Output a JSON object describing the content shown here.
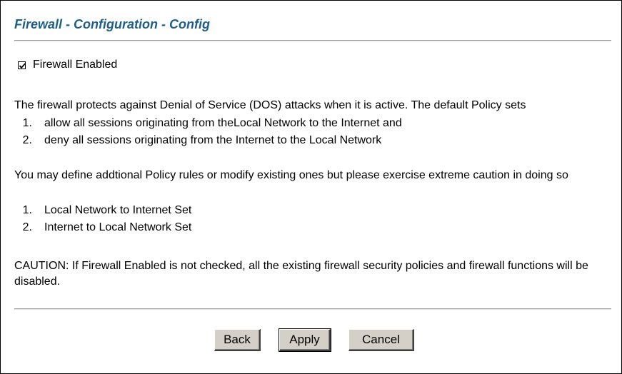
{
  "header": {
    "title": "Firewall - Configuration - Config"
  },
  "firewall": {
    "enabled_label": "Firewall Enabled",
    "enabled": true
  },
  "intro": {
    "text": "The firewall protects against Denial of Service (DOS) attacks when it is active. The default Policy sets",
    "items": [
      {
        "num": "1.",
        "text": "allow all sessions originating from theLocal Network to the Internet and"
      },
      {
        "num": "2.",
        "text": "deny all sessions originating from the Internet to the Local Network"
      }
    ]
  },
  "policy": {
    "text": "You may define addtional Policy rules or modify existing ones but please exercise extreme caution in doing so",
    "items": [
      {
        "num": "1.",
        "text": "Local Network to Internet Set"
      },
      {
        "num": "2.",
        "text": "Internet to Local Network Set"
      }
    ]
  },
  "caution": {
    "text": "CAUTION: If Firewall Enabled is not checked, all the existing firewall security policies and firewall functions will be disabled."
  },
  "buttons": {
    "back": "Back",
    "apply": "Apply",
    "cancel": "Cancel"
  }
}
